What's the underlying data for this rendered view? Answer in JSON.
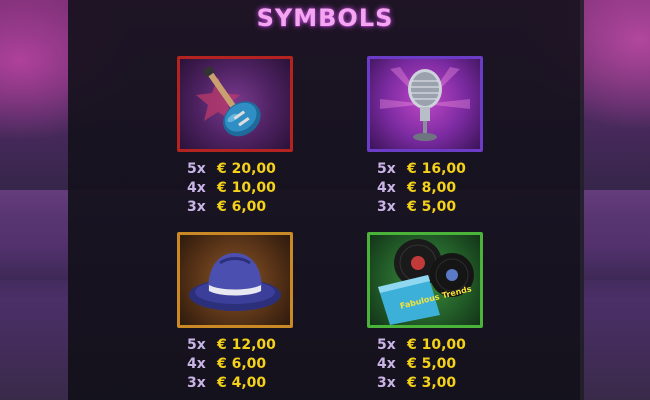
{
  "title": "SYMBOLS",
  "symbols": [
    {
      "icon": "guitar-icon",
      "border_color": "#b3231f",
      "payouts": [
        {
          "count": "5x",
          "amount": "€ 20,00"
        },
        {
          "count": "4x",
          "amount": "€ 10,00"
        },
        {
          "count": "3x",
          "amount": "€ 6,00"
        }
      ]
    },
    {
      "icon": "microphone-icon",
      "border_color": "#6b3cc6",
      "payouts": [
        {
          "count": "5x",
          "amount": "€ 16,00"
        },
        {
          "count": "4x",
          "amount": "€ 8,00"
        },
        {
          "count": "3x",
          "amount": "€ 5,00"
        }
      ]
    },
    {
      "icon": "fedora-hat-icon",
      "border_color": "#c98a26",
      "payouts": [
        {
          "count": "5x",
          "amount": "€ 12,00"
        },
        {
          "count": "4x",
          "amount": "€ 6,00"
        },
        {
          "count": "3x",
          "amount": "€ 4,00"
        }
      ]
    },
    {
      "icon": "vinyl-records-icon",
      "border_color": "#4bb23a",
      "album_text": "Fabulous Trends",
      "payouts": [
        {
          "count": "5x",
          "amount": "€ 10,00"
        },
        {
          "count": "4x",
          "amount": "€ 5,00"
        },
        {
          "count": "3x",
          "amount": "€ 3,00"
        }
      ]
    }
  ],
  "colors": {
    "title": "#f4a6f0",
    "count": "#c9b4e6",
    "amount": "#f5d21a"
  }
}
